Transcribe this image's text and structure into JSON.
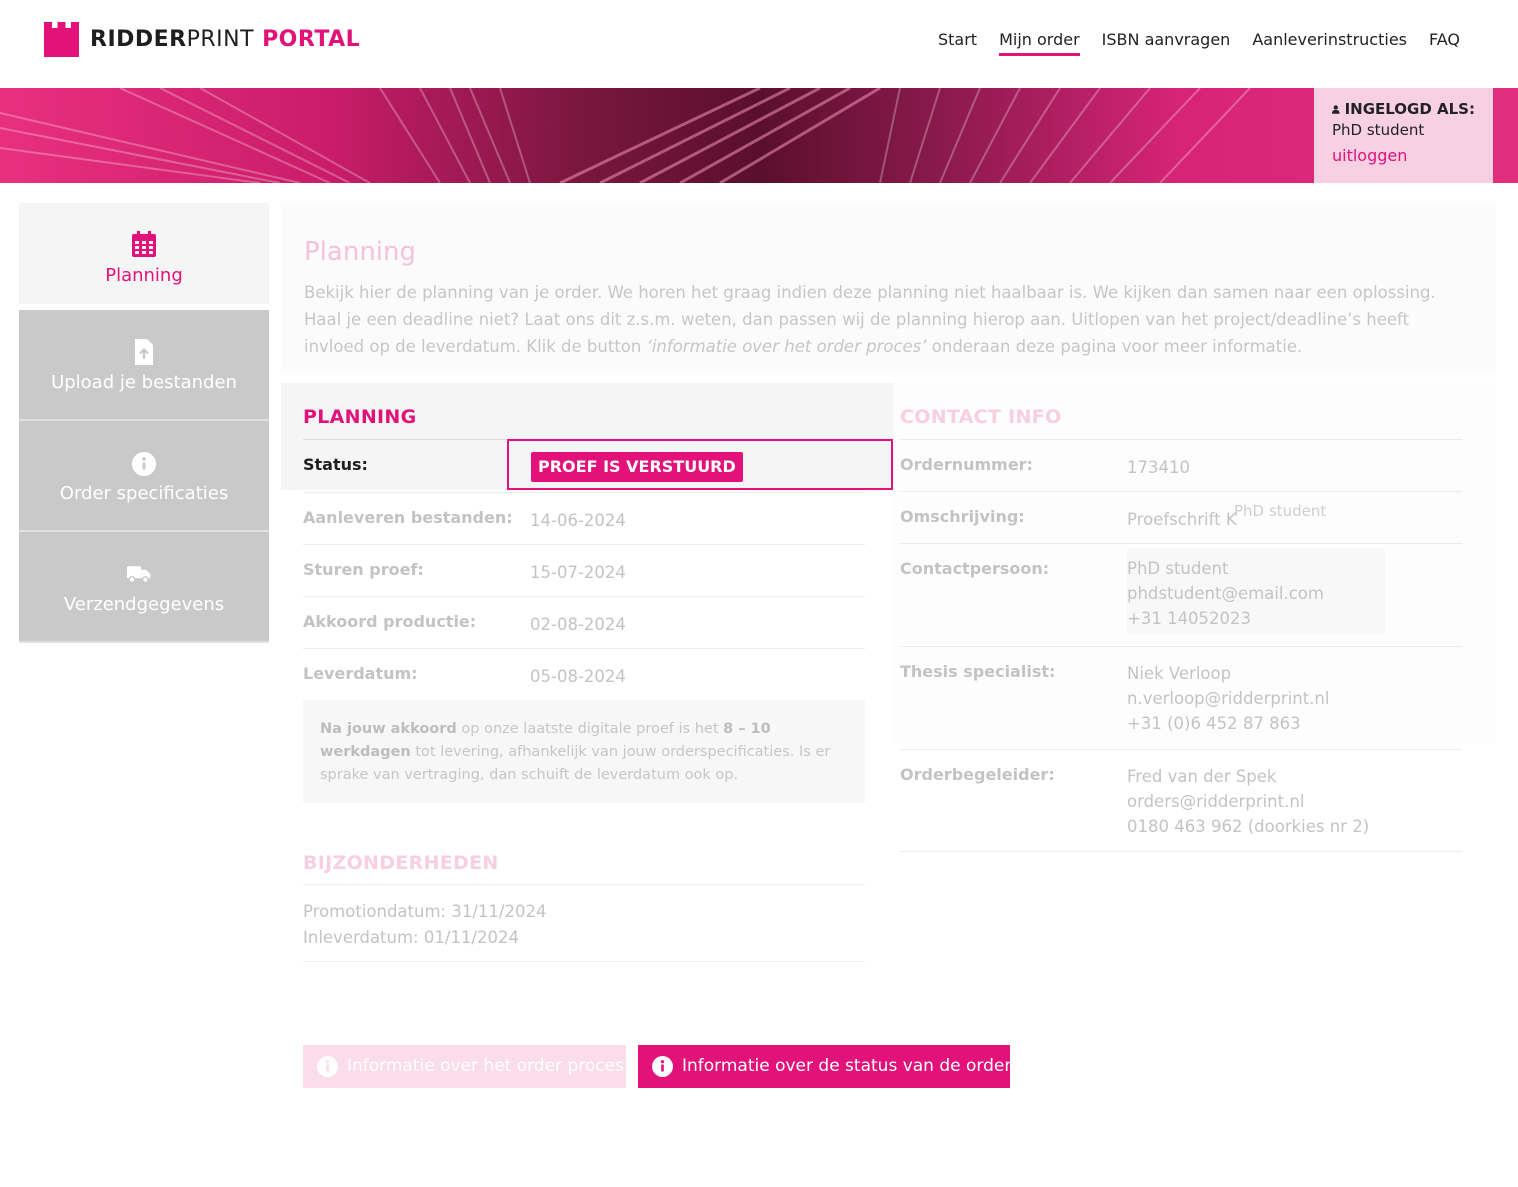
{
  "header": {
    "logo": {
      "part1": "RIDDER",
      "part2": "PRINT",
      "part3": "PORTAL"
    },
    "nav": [
      {
        "label": "Start"
      },
      {
        "label": "Mijn order"
      },
      {
        "label": "ISBN aanvragen"
      },
      {
        "label": "Aanleverinstructies"
      },
      {
        "label": "FAQ"
      }
    ],
    "active_nav": "Mijn order"
  },
  "login": {
    "title": "INGELOGD ALS:",
    "name": "PhD student",
    "logout": "uitloggen"
  },
  "sidebar": {
    "items": [
      {
        "label": "Planning",
        "icon": "calendar-icon"
      },
      {
        "label": "Upload je bestanden",
        "icon": "file-upload-icon"
      },
      {
        "label": "Order specificaties",
        "icon": "info-icon"
      },
      {
        "label": "Verzendgegevens",
        "icon": "truck-icon"
      }
    ]
  },
  "intro": {
    "title": "Planning",
    "text_before": "Bekijk hier de planning van je order. We horen het graag indien deze planning niet haalbaar is. We kijken dan samen naar een oplossing. Haal je een deadline niet? Laat ons dit z.s.m. weten, dan passen wij de planning hierop aan. Uitlopen van het project/deadline’s heeft invloed op de leverdatum. Klik de button ",
    "text_em": "‘informatie over het order proces’",
    "text_after": " onderaan deze pagina voor meer informatie."
  },
  "planning": {
    "title": "PLANNING",
    "status_label": "Status:",
    "status_value": "PROEF IS VERSTUURD",
    "rows": [
      {
        "label": "Aanleveren bestanden:",
        "value": "14-06-2024"
      },
      {
        "label": "Sturen proef:",
        "value": "15-07-2024"
      },
      {
        "label": "Akkoord productie:",
        "value": "02-08-2024"
      },
      {
        "label": "Leverdatum:",
        "value": "05-08-2024"
      }
    ],
    "note": {
      "b1": "Na jouw akkoord",
      "t1": " op onze laatste digitale proef is het ",
      "b2": "8 – 10 werkdagen",
      "t2": " tot levering, afhankelijk van jouw orderspecificaties. Is er sprake van vertraging, dan schuift de leverdatum ook op."
    }
  },
  "bijzonderheden": {
    "title": "BIJZONDERHEDEN",
    "line1": "Promotiondatum: 31/11/2024",
    "line2": "Inleverdatum: 01/11/2024"
  },
  "contact": {
    "title": "CONTACT INFO",
    "ordernummer_label": "Ordernummer:",
    "ordernummer": "173410",
    "omschrijving_label": "Omschrijving:",
    "omschrijving": "Proefschrift K",
    "omschrijving_overlay": "PhD student",
    "contactpersoon_label": "Contactpersoon:",
    "contactpersoon": [
      "PhD student",
      "phdstudent@email.com",
      "+31 14052023"
    ],
    "thesis_label": "Thesis specialist:",
    "thesis": [
      "Niek Verloop",
      "n.verloop@ridderprint.nl",
      "+31 (0)6 452 87 863"
    ],
    "begeleider_label": "Orderbegeleider:",
    "begeleider": [
      "Fred van der Spek",
      "orders@ridderprint.nl",
      "0180 463 962 (doorkies nr 2)"
    ]
  },
  "buttons": {
    "process": "Informatie over het order proces",
    "status": "Informatie over de status van de order"
  },
  "colors": {
    "accent": "#e2127a",
    "sidebar": "#c9c9c9",
    "faded_text": "#c3c3c3"
  }
}
